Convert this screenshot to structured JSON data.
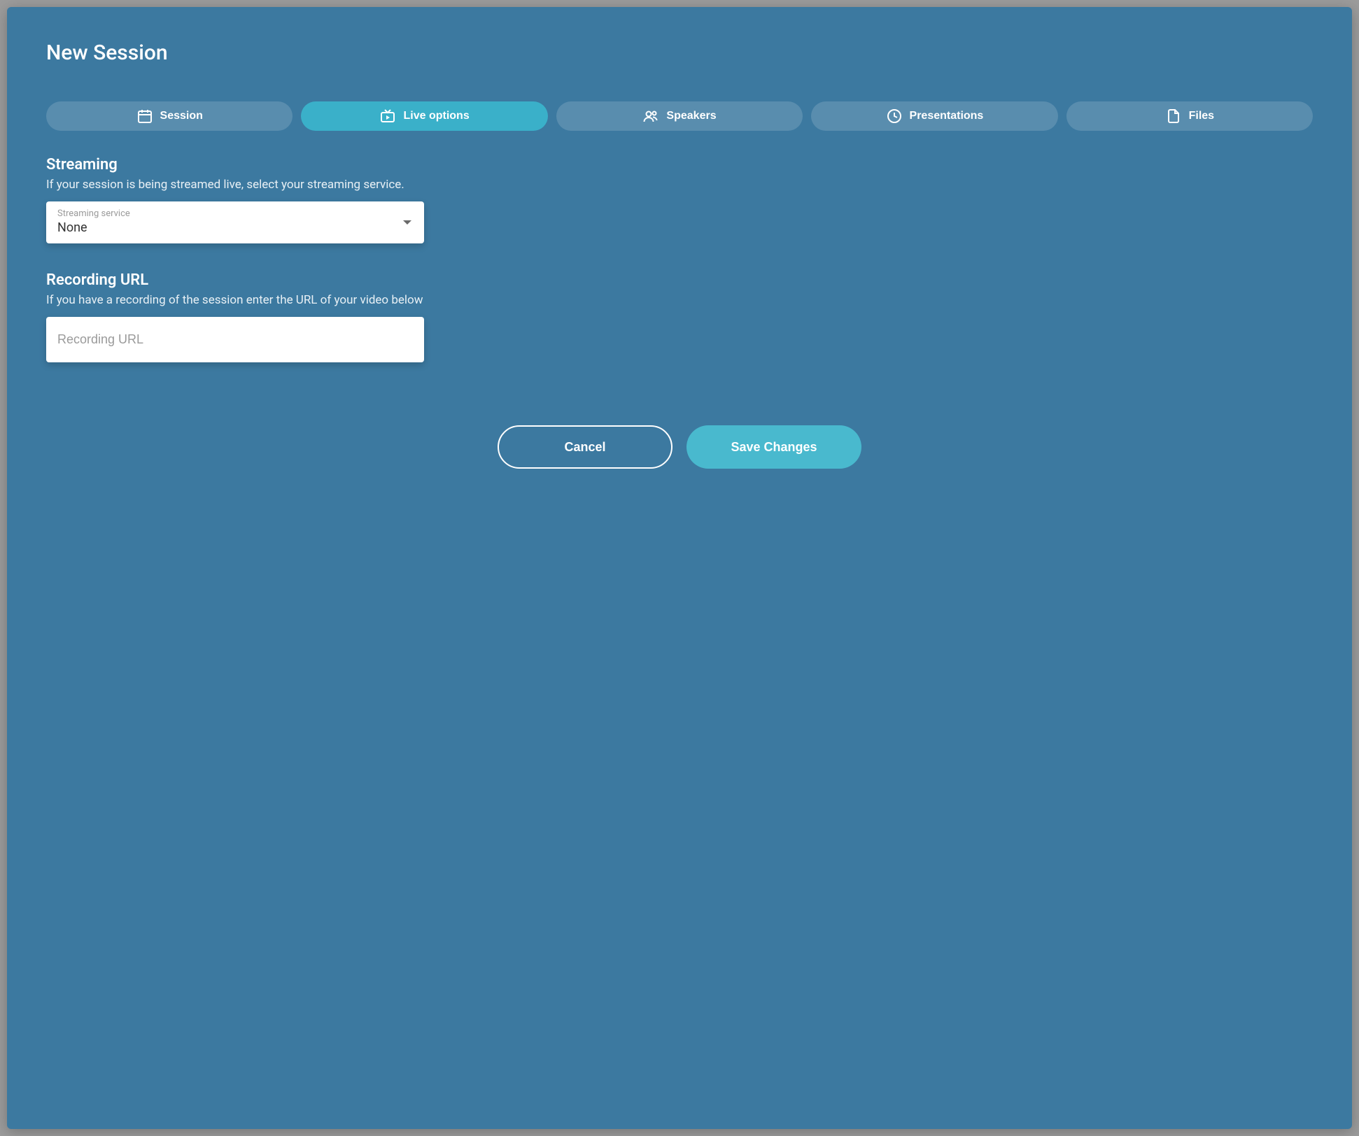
{
  "modal": {
    "title": "New Session"
  },
  "tabs": [
    {
      "label": "Session",
      "icon": "calendar-icon",
      "active": false
    },
    {
      "label": "Live options",
      "icon": "tv-play-icon",
      "active": true
    },
    {
      "label": "Speakers",
      "icon": "people-icon",
      "active": false
    },
    {
      "label": "Presentations",
      "icon": "clock-icon",
      "active": false
    },
    {
      "label": "Files",
      "icon": "file-icon",
      "active": false
    }
  ],
  "streaming": {
    "title": "Streaming",
    "description": "If your session is being streamed live, select your streaming service.",
    "select_label": "Streaming service",
    "select_value": "None"
  },
  "recording": {
    "title": "Recording URL",
    "description": "If you have a recording of the session enter the URL of your video below",
    "placeholder": "Recording URL",
    "value": ""
  },
  "actions": {
    "cancel": "Cancel",
    "save": "Save Changes"
  }
}
